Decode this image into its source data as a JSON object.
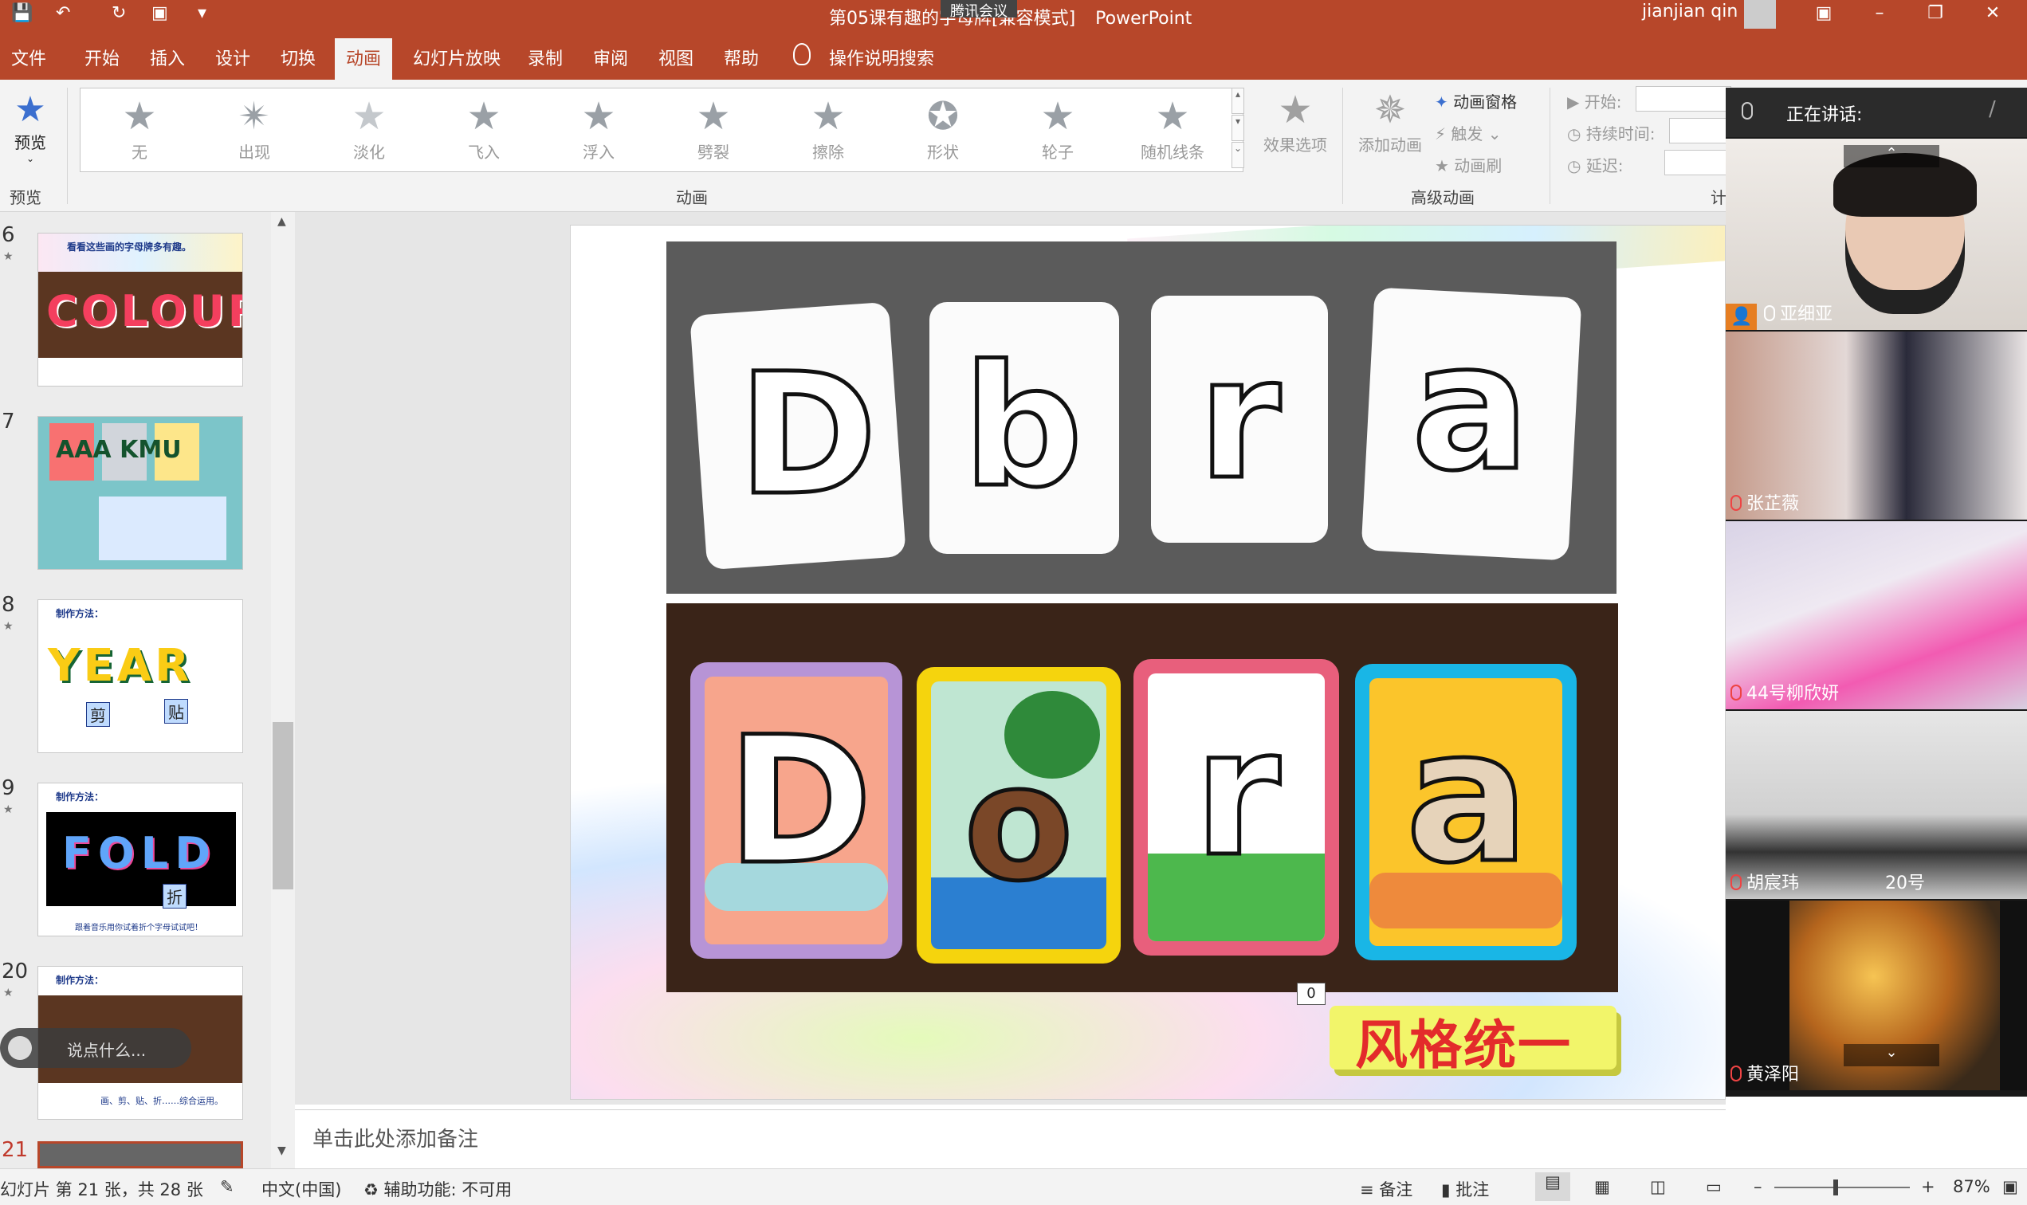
{
  "titlebar": {
    "doc_title": "第05课有趣的字母牌[兼容模式]",
    "app_name": "PowerPoint",
    "meeting_badge": "腾讯会议",
    "user": "jianjian qin"
  },
  "tabs": [
    "文件",
    "开始",
    "插入",
    "设计",
    "切换",
    "动画",
    "幻灯片放映",
    "录制",
    "审阅",
    "视图",
    "帮助"
  ],
  "active_tab": "动画",
  "tell_me": "操作说明搜索",
  "ribbon": {
    "preview_label": "预览",
    "preview_group": "预览",
    "animations": [
      "无",
      "出现",
      "淡化",
      "飞入",
      "浮入",
      "劈裂",
      "擦除",
      "形状",
      "轮子",
      "随机线条"
    ],
    "effect_options": "效果选项",
    "animation_group": "动画",
    "add_animation": "添加动画",
    "animation_pane": "动画窗格",
    "trigger": "触发",
    "animation_painter": "动画刷",
    "advanced_group": "高级动画",
    "timing": {
      "start": "开始:",
      "duration": "持续时间:",
      "delay": "延迟:"
    },
    "timing_group_partial": "计"
  },
  "thumbnails": [
    {
      "num": "6",
      "caption": "看看这些画的字母牌多有趣。",
      "text": "COLOUR"
    },
    {
      "num": "7",
      "caption": "",
      "text": "AAA KMU"
    },
    {
      "num": "8",
      "caption": "制作方法：",
      "text": "YEAR",
      "tags": [
        "剪",
        "贴"
      ]
    },
    {
      "num": "9",
      "caption": "制作方法：",
      "text": "FOLD",
      "tag": "折",
      "footer": "跟着音乐用你试着折个字母试试吧！"
    },
    {
      "num": "20",
      "caption": "制作方法：",
      "footer": "画、剪、贴、折……综合运用。"
    },
    {
      "num": "21"
    }
  ],
  "chat_placeholder": "说点什么...",
  "slide": {
    "top_cards": [
      "D",
      "b",
      "r",
      "a"
    ],
    "bottom_cards": [
      "D",
      "o",
      "r",
      "a"
    ],
    "zero_tag": "0",
    "banner": "风格统一"
  },
  "notes_placeholder": "单击此处添加备注",
  "statusbar": {
    "slide_info": "幻灯片 第 21 张，共 28 张",
    "language": "中文(中国)",
    "accessibility": "辅助功能: 不可用",
    "notes": "备注",
    "comments": "批注",
    "zoom": "87%"
  },
  "meeting": {
    "speaking_label": "正在讲话:",
    "participants": [
      {
        "name": "亚细亚",
        "host": true
      },
      {
        "name": "张芷薇"
      },
      {
        "name": "44号柳欣妍"
      },
      {
        "name": "胡宸玮",
        "extra": "20号"
      },
      {
        "name": "黄泽阳"
      }
    ]
  },
  "colors": {
    "accent": "#b7472a",
    "ribbon_bg": "#f3f3f3",
    "banner_text": "#e32b2b",
    "banner_bg": "#f2f56a"
  }
}
